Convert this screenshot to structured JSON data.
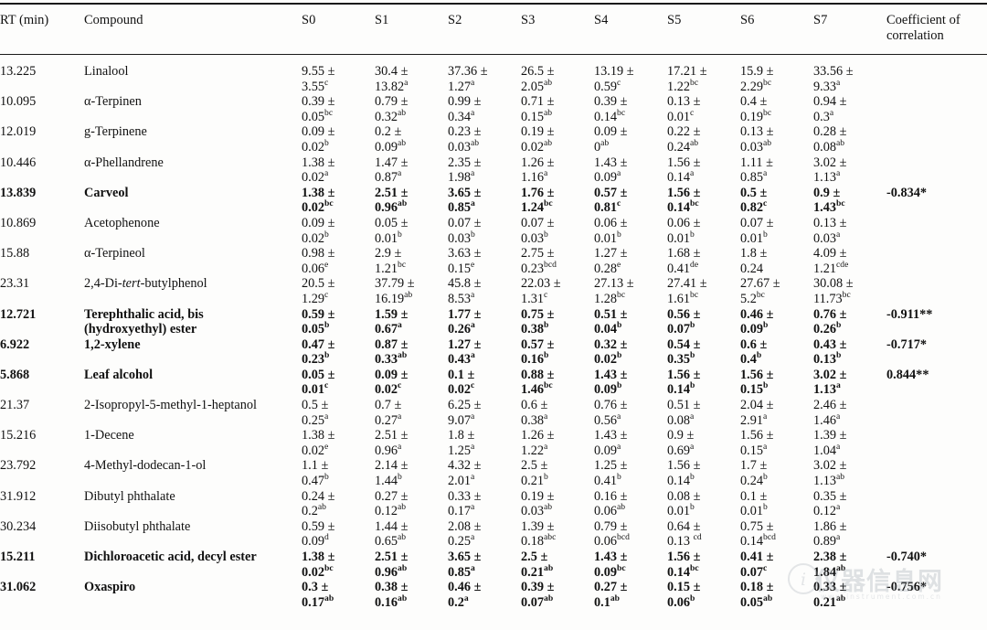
{
  "document": {
    "type": "scientific-data-table",
    "clipped_line_above": " "
  },
  "watermark": {
    "logo_glyph": "i",
    "text": "仪器信息网",
    "sub": "www.instrument.com.cn"
  },
  "table": {
    "headers": {
      "rt": "RT (min)",
      "compound": "Compound",
      "s0": "S0",
      "s1": "S1",
      "s2": "S2",
      "s3": "S3",
      "s4": "S4",
      "s5": "S5",
      "s6": "S6",
      "s7": "S7",
      "coefficient_line1": "Coefficient of",
      "coefficient_line2": "correlation"
    },
    "rows": [
      {
        "bold": false,
        "rt": "13.225",
        "compound": "Linalool",
        "compound_html": "Linalool",
        "s0": [
          "9.55 ±",
          "3.55",
          "c"
        ],
        "s1": [
          "30.4 ±",
          "13.82",
          "a"
        ],
        "s2": [
          "37.36 ±",
          "1.27",
          "a"
        ],
        "s3": [
          "26.5 ±",
          "2.05",
          "ab"
        ],
        "s4": [
          "13.19 ±",
          "0.59",
          "c"
        ],
        "s5": [
          "17.21 ±",
          "1.22",
          "bc"
        ],
        "s6": [
          "15.9 ±",
          "2.29",
          "bc"
        ],
        "s7": [
          "33.56 ±",
          "9.33",
          "a"
        ],
        "coefficient": ""
      },
      {
        "bold": false,
        "rt": "10.095",
        "compound": "α-Terpinen",
        "compound_html": "α-Terpinen",
        "s0": [
          "0.39 ±",
          "0.05",
          "bc"
        ],
        "s1": [
          "0.79 ±",
          "0.32",
          "ab"
        ],
        "s2": [
          "0.99 ±",
          "0.34",
          "a"
        ],
        "s3": [
          "0.71 ±",
          "0.15",
          "ab"
        ],
        "s4": [
          "0.39 ±",
          "0.14",
          "bc"
        ],
        "s5": [
          "0.13 ±",
          "0.01",
          "c"
        ],
        "s6": [
          "0.4 ±",
          "0.19",
          "bc"
        ],
        "s7": [
          "0.94 ±",
          "0.3",
          "a"
        ],
        "coefficient": ""
      },
      {
        "bold": false,
        "rt": "12.019",
        "compound": "g-Terpinene",
        "compound_html": "g-Terpinene",
        "s0": [
          "0.09 ±",
          "0.02",
          "b"
        ],
        "s1": [
          "0.2 ±",
          "0.09",
          "ab"
        ],
        "s2": [
          "0.23 ±",
          "0.03",
          "ab"
        ],
        "s3": [
          "0.19 ±",
          "0.02",
          "ab"
        ],
        "s4": [
          "0.09 ±",
          "0",
          "ab"
        ],
        "s5": [
          "0.22 ±",
          "0.24",
          "ab"
        ],
        "s6": [
          "0.13 ±",
          "0.03",
          "ab"
        ],
        "s7": [
          "0.28 ±",
          "0.08",
          "ab"
        ],
        "coefficient": ""
      },
      {
        "bold": false,
        "rt": "10.446",
        "compound": "α-Phellandrene",
        "compound_html": "α-Phellandrene",
        "s0": [
          "1.38 ±",
          "0.02",
          "a"
        ],
        "s1": [
          "1.47 ±",
          "0.87",
          "a"
        ],
        "s2": [
          "2.35 ±",
          "1.98",
          "a"
        ],
        "s3": [
          "1.26 ±",
          "1.16",
          "a"
        ],
        "s4": [
          "1.43 ±",
          "0.09",
          "a"
        ],
        "s5": [
          "1.56 ±",
          "0.14",
          "a"
        ],
        "s6": [
          "1.11 ±",
          "0.85",
          "a"
        ],
        "s7": [
          "3.02 ±",
          "1.13",
          "a"
        ],
        "coefficient": ""
      },
      {
        "bold": true,
        "rt": "13.839",
        "compound": "Carveol",
        "compound_html": "Carveol",
        "s0": [
          "1.38 ±",
          "0.02",
          "bc"
        ],
        "s1": [
          "2.51 ±",
          "0.96",
          "ab"
        ],
        "s2": [
          "3.65 ±",
          "0.85",
          "a"
        ],
        "s3": [
          "1.76 ±",
          "1.24",
          "bc"
        ],
        "s4": [
          "0.57 ±",
          "0.81",
          "c"
        ],
        "s5": [
          "1.56 ±",
          "0.14",
          "bc"
        ],
        "s6": [
          "0.5 ±",
          "0.82",
          "c"
        ],
        "s7": [
          "0.9 ±",
          "1.43",
          "bc"
        ],
        "coefficient": "-0.834*"
      },
      {
        "bold": false,
        "rt": "10.869",
        "compound": "Acetophenone",
        "compound_html": "Acetophenone",
        "s0": [
          "0.09 ±",
          "0.02",
          "b"
        ],
        "s1": [
          "0.05 ±",
          "0.01",
          "b"
        ],
        "s2": [
          "0.07 ±",
          "0.03",
          "b"
        ],
        "s3": [
          "0.07 ±",
          "0.03",
          "b"
        ],
        "s4": [
          "0.06 ±",
          "0.01",
          "b"
        ],
        "s5": [
          "0.06 ±",
          "0.01",
          "b"
        ],
        "s6": [
          "0.07 ±",
          "0.01",
          "b"
        ],
        "s7": [
          "0.13 ±",
          "0.03",
          "a"
        ],
        "coefficient": ""
      },
      {
        "bold": false,
        "rt": "15.88",
        "compound": "α-Terpineol",
        "compound_html": "α-Terpineol",
        "s0": [
          "0.98 ±",
          "0.06",
          "e"
        ],
        "s1": [
          "2.9 ±",
          "1.21",
          "bc"
        ],
        "s2": [
          "3.63 ±",
          "0.15",
          "e"
        ],
        "s3": [
          "2.75 ±",
          "0.23",
          "bcd"
        ],
        "s4": [
          "1.27 ±",
          "0.28",
          "e"
        ],
        "s5": [
          "1.68 ±",
          "0.41",
          "de"
        ],
        "s6": [
          "1.8 ±",
          "0.24",
          ""
        ],
        "s7": [
          "4.09 ±",
          "1.21",
          "cde"
        ],
        "coefficient": ""
      },
      {
        "bold": false,
        "rt": "23.31",
        "compound": "2,4-Di-tert-butylphenol",
        "compound_html": "2,4-Di-<i>tert</i>-butylphenol",
        "s0": [
          "20.5 ±",
          "1.29",
          "c"
        ],
        "s1": [
          "37.79 ±",
          "16.19",
          "ab"
        ],
        "s2": [
          "45.8 ±",
          "8.53",
          "a"
        ],
        "s3": [
          "22.03 ±",
          "1.31",
          "c"
        ],
        "s4": [
          "27.13 ±",
          "1.28",
          "bc"
        ],
        "s5": [
          "27.41 ±",
          "1.61",
          "bc"
        ],
        "s6": [
          "27.67 ±",
          "5.2",
          "bc"
        ],
        "s7": [
          "30.08 ±",
          "11.73",
          "bc"
        ],
        "coefficient": ""
      },
      {
        "bold": true,
        "rt": "12.721",
        "compound": "Terephthalic acid, bis (hydroxyethyl) ester",
        "compound_html": "Terephthalic acid, bis<br>(hydroxyethyl) ester",
        "s0": [
          "0.59 ±",
          "0.05",
          "b"
        ],
        "s1": [
          "1.59 ±",
          "0.67",
          "a"
        ],
        "s2": [
          "1.77 ±",
          "0.26",
          "a"
        ],
        "s3": [
          "0.75 ±",
          "0.38",
          "b"
        ],
        "s4": [
          "0.51 ±",
          "0.04",
          "b"
        ],
        "s5": [
          "0.56 ±",
          "0.07",
          "b"
        ],
        "s6": [
          "0.46 ±",
          "0.09",
          "b"
        ],
        "s7": [
          "0.76 ±",
          "0.26",
          "b"
        ],
        "coefficient": "-0.911**"
      },
      {
        "bold": true,
        "rt": "6.922",
        "compound": "1,2-xylene",
        "compound_html": "1,2-xylene",
        "s0": [
          "0.47 ±",
          "0.23",
          "b"
        ],
        "s1": [
          "0.87 ±",
          "0.33",
          "ab"
        ],
        "s2": [
          "1.27 ±",
          "0.43",
          "a"
        ],
        "s3": [
          "0.57 ±",
          "0.16",
          "b"
        ],
        "s4": [
          "0.32 ±",
          "0.02",
          "b"
        ],
        "s5": [
          "0.54 ±",
          "0.35",
          "b"
        ],
        "s6": [
          "0.6 ±",
          "0.4",
          "b"
        ],
        "s7": [
          "0.43 ±",
          "0.13",
          "b"
        ],
        "coefficient": "-0.717*"
      },
      {
        "bold": true,
        "rt": "5.868",
        "compound": "Leaf alcohol",
        "compound_html": "Leaf alcohol",
        "s0": [
          "0.05 ±",
          "0.01",
          "c"
        ],
        "s1": [
          "0.09 ±",
          "0.02",
          "c"
        ],
        "s2": [
          "0.1 ±",
          "0.02",
          "c"
        ],
        "s3": [
          "0.88 ±",
          "1.46",
          "bc"
        ],
        "s4": [
          "1.43 ±",
          "0.09",
          "b"
        ],
        "s5": [
          "1.56 ±",
          "0.14",
          "b"
        ],
        "s6": [
          "1.56 ±",
          "0.15",
          "b"
        ],
        "s7": [
          "3.02 ±",
          "1.13",
          "a"
        ],
        "coefficient": "0.844**"
      },
      {
        "bold": false,
        "rt": "21.37",
        "compound": "2-Isopropyl-5-methyl-1-heptanol",
        "compound_html": "2-Isopropyl-5-methyl-1-heptanol",
        "s0": [
          "0.5 ±",
          "0.25",
          "a"
        ],
        "s1": [
          "0.7 ±",
          "0.27",
          "a"
        ],
        "s2": [
          "6.25 ±",
          "9.07",
          "a"
        ],
        "s3": [
          "0.6 ±",
          "0.38",
          "a"
        ],
        "s4": [
          "0.76 ±",
          "0.56",
          "a"
        ],
        "s5": [
          "0.51 ±",
          "0.08",
          "a"
        ],
        "s6": [
          "2.04 ±",
          "2.91",
          "a"
        ],
        "s7": [
          "2.46 ±",
          "1.46",
          "a"
        ],
        "coefficient": ""
      },
      {
        "bold": false,
        "rt": "15.216",
        "compound": "1-Decene",
        "compound_html": "1-Decene",
        "s0": [
          "1.38 ±",
          "0.02",
          "e"
        ],
        "s1": [
          "2.51 ±",
          "0.96",
          "a"
        ],
        "s2": [
          "1.8 ±",
          "1.25",
          "a"
        ],
        "s3": [
          "1.26 ±",
          "1.22",
          "a"
        ],
        "s4": [
          "1.43 ±",
          "0.09",
          "a"
        ],
        "s5": [
          "0.9 ±",
          "0.69",
          "a"
        ],
        "s6": [
          "1.56 ±",
          "0.15",
          "a"
        ],
        "s7": [
          "1.39 ±",
          "1.04",
          "a"
        ],
        "coefficient": ""
      },
      {
        "bold": false,
        "rt": "23.792",
        "compound": "4-Methyl-dodecan-1-ol",
        "compound_html": "4-Methyl-dodecan-1-ol",
        "s0": [
          "1.1 ±",
          "0.47",
          "b"
        ],
        "s1": [
          "2.14 ±",
          "1.44",
          "b"
        ],
        "s2": [
          "4.32 ±",
          "2.01",
          "a"
        ],
        "s3": [
          "2.5 ±",
          "0.21",
          "b"
        ],
        "s4": [
          "1.25 ±",
          "0.41",
          "b"
        ],
        "s5": [
          "1.56 ±",
          "0.14",
          "b"
        ],
        "s6": [
          "1.7 ±",
          "0.24",
          "b"
        ],
        "s7": [
          "3.02 ±",
          "1.13",
          "ab"
        ],
        "coefficient": ""
      },
      {
        "bold": false,
        "rt": "31.912",
        "compound": "Dibutyl phthalate",
        "compound_html": "Dibutyl phthalate",
        "s0": [
          "0.24 ±",
          "0.2",
          "ab"
        ],
        "s1": [
          "0.27 ±",
          "0.12",
          "ab"
        ],
        "s2": [
          "0.33 ±",
          "0.17",
          "a"
        ],
        "s3": [
          "0.19 ±",
          "0.03",
          "ab"
        ],
        "s4": [
          "0.16 ±",
          "0.06",
          "ab"
        ],
        "s5": [
          "0.08 ±",
          "0.01",
          "b"
        ],
        "s6": [
          "0.1 ±",
          "0.01",
          "b"
        ],
        "s7": [
          "0.35 ±",
          "0.12",
          "a"
        ],
        "coefficient": ""
      },
      {
        "bold": false,
        "rt": "30.234",
        "compound": "Diisobutyl phthalate",
        "compound_html": "Diisobutyl phthalate",
        "s0": [
          "0.59 ±",
          "0.09",
          "d"
        ],
        "s1": [
          "1.44 ±",
          "0.65",
          "ab"
        ],
        "s2": [
          "2.08 ±",
          "0.25",
          "a"
        ],
        "s3": [
          "1.39 ±",
          "0.18",
          "abc"
        ],
        "s4": [
          "0.79 ±",
          "0.06",
          "bcd"
        ],
        "s5": [
          "0.64 ±",
          "0.13 ",
          "cd"
        ],
        "s6": [
          "0.75 ±",
          "0.14",
          "bcd"
        ],
        "s7": [
          "1.86 ±",
          "0.89",
          "a"
        ],
        "coefficient": ""
      },
      {
        "bold": true,
        "rt": "15.211",
        "compound": "Dichloroacetic acid, decyl ester",
        "compound_html": "Dichloroacetic acid, decyl ester",
        "s0": [
          "1.38 ±",
          "0.02",
          "bc"
        ],
        "s1": [
          "2.51 ±",
          "0.96",
          "ab"
        ],
        "s2": [
          "3.65 ±",
          "0.85",
          "a"
        ],
        "s3": [
          "2.5 ±",
          "0.21",
          "ab"
        ],
        "s4": [
          "1.43 ±",
          "0.09",
          "bc"
        ],
        "s5": [
          "1.56 ±",
          "0.14",
          "bc"
        ],
        "s6": [
          "0.41 ±",
          "0.07",
          "c"
        ],
        "s7": [
          "2.38 ±",
          "1.84",
          "ab"
        ],
        "coefficient": "-0.740*"
      },
      {
        "bold": true,
        "rt": "31.062",
        "compound": "Oxaspiro",
        "compound_html": "Oxaspiro",
        "s0": [
          "0.3 ±",
          "0.17",
          "ab"
        ],
        "s1": [
          "0.38 ±",
          "0.16",
          "ab"
        ],
        "s2": [
          "0.46 ±",
          "0.2",
          "a"
        ],
        "s3": [
          "0.39 ±",
          "0.07",
          "ab"
        ],
        "s4": [
          "0.27 ±",
          "0.1",
          "ab"
        ],
        "s5": [
          "0.15 ±",
          "0.06",
          "b"
        ],
        "s6": [
          "0.18 ±",
          "0.05",
          "ab"
        ],
        "s7": [
          "0.33 ±",
          "0.21",
          "ab"
        ],
        "coefficient": "-0.756*"
      }
    ]
  }
}
